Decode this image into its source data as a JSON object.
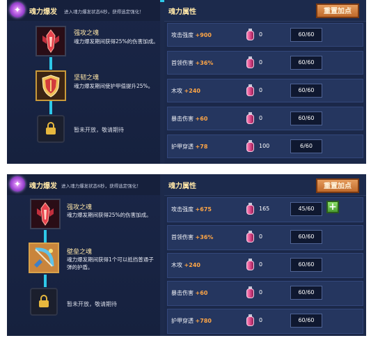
{
  "colors": {
    "accent": "#ffa646",
    "title": "#ffe7a8",
    "panel": "#1d2a4b",
    "reset_button": "#d98445",
    "potion": "#e0508f",
    "connector": "#2ec8e8"
  },
  "panels": [
    {
      "header": {
        "title": "魂力爆发",
        "description": "进入魂力爆发状态6秒，获得选定强化！",
        "icon": "soul-orb-icon"
      },
      "attributes_title": "魂力属性",
      "reset_label": "重置加点",
      "skills": [
        {
          "name": "强攻之魂",
          "desc": "魂力爆发期间获得25%的伤害加成。",
          "icon": "red-sword-emblem-icon"
        },
        {
          "name": "坚韧之魂",
          "desc": "魂力爆发期间使护甲值提升25%。",
          "icon": "shield-emblem-icon"
        }
      ],
      "locked": {
        "text": "暂未开放，敬请期待",
        "icon": "lock-icon"
      },
      "stats": [
        {
          "name": "攻击强度",
          "bonus": "+900",
          "count": "0",
          "level": "60/60"
        },
        {
          "name": "首领伤害",
          "bonus": "+36%",
          "count": "0",
          "level": "60/60"
        },
        {
          "name": "木攻",
          "bonus": "+240",
          "count": "0",
          "level": "60/60"
        },
        {
          "name": "暴击伤害",
          "bonus": "+60",
          "count": "0",
          "level": "60/60"
        },
        {
          "name": "护甲穿透",
          "bonus": "+78",
          "count": "100",
          "level": "6/60"
        }
      ]
    },
    {
      "header": {
        "title": "魂力爆发",
        "description": "进入魂力爆发状态6秒，获得选定强化！",
        "icon": "soul-orb-icon"
      },
      "attributes_title": "魂力属性",
      "reset_label": "重置加点",
      "skills": [
        {
          "name": "强攻之魂",
          "desc": "魂力爆发期间获得25%的伤害加成。",
          "icon": "red-sword-emblem-icon"
        },
        {
          "name": "壁垒之魂",
          "desc": "魂力爆发期间获得1个可以抵挡普通子弹的护盾。",
          "icon": "bulwark-bow-emblem-icon"
        }
      ],
      "locked": {
        "text": "暂未开放，敬请期待",
        "icon": "lock-icon"
      },
      "stats": [
        {
          "name": "攻击强度",
          "bonus": "+675",
          "count": "165",
          "level": "45/60",
          "plus": "+"
        },
        {
          "name": "首领伤害",
          "bonus": "+36%",
          "count": "0",
          "level": "60/60"
        },
        {
          "name": "木攻",
          "bonus": "+240",
          "count": "0",
          "level": "60/60"
        },
        {
          "name": "暴击伤害",
          "bonus": "+60",
          "count": "0",
          "level": "60/60"
        },
        {
          "name": "护甲穿透",
          "bonus": "+780",
          "count": "0",
          "level": "60/60"
        }
      ]
    }
  ]
}
